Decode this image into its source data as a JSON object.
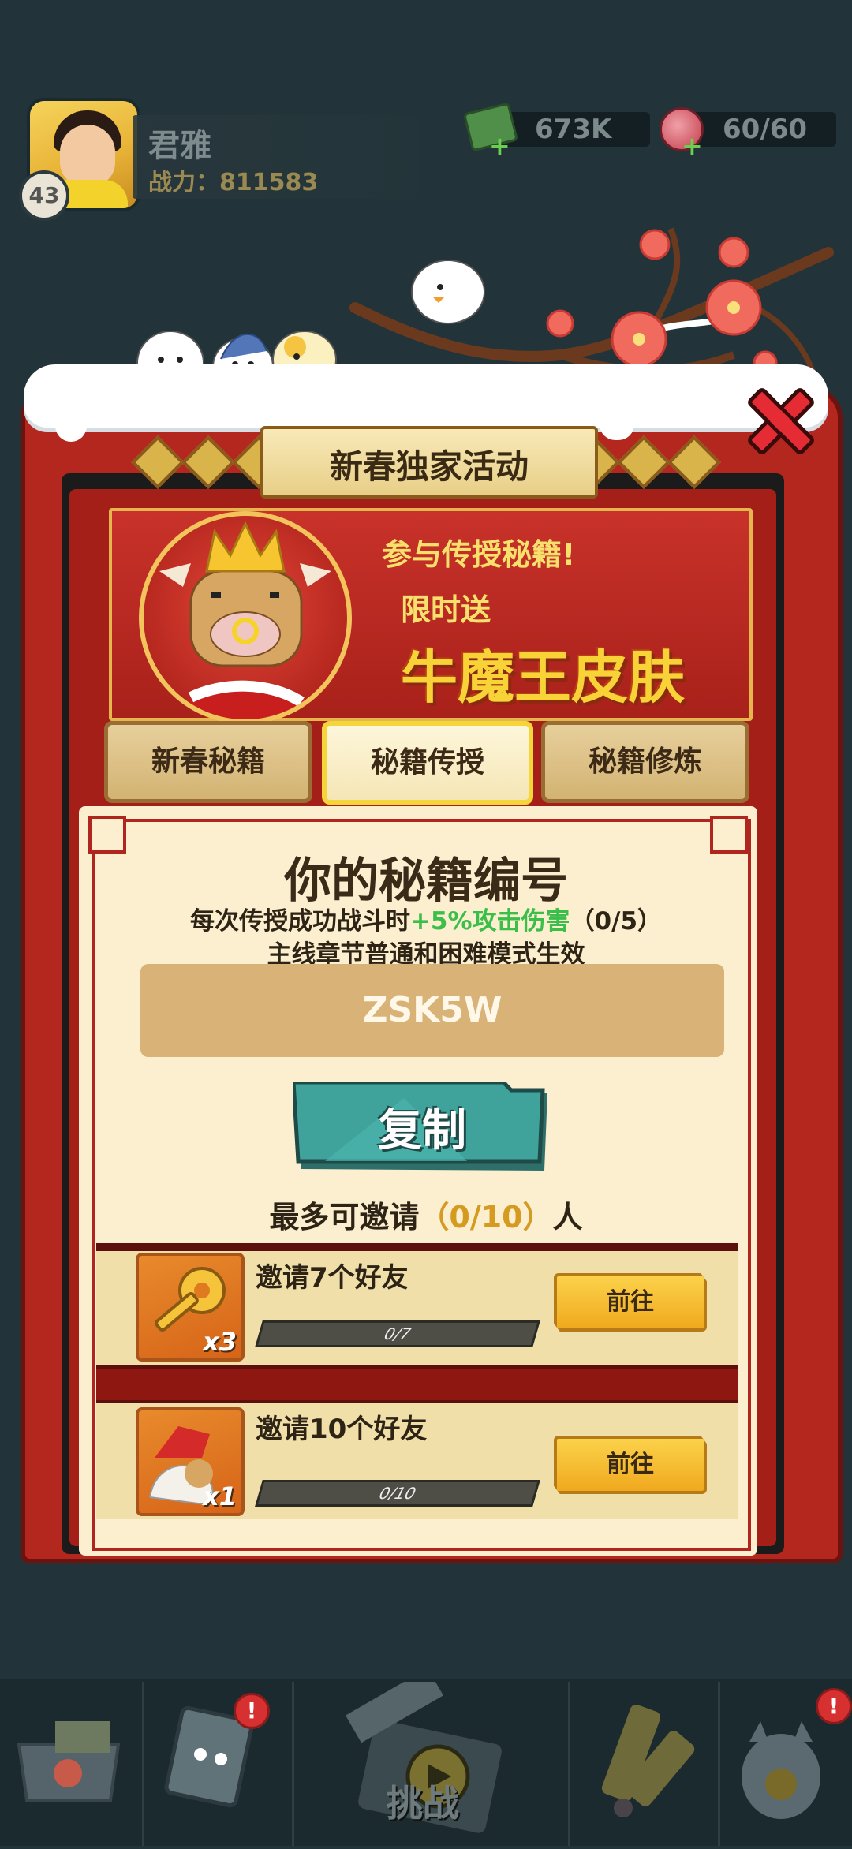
{
  "player": {
    "name": "君雅",
    "level": "43",
    "power": "战力：811583"
  },
  "resources": {
    "money": "673K",
    "stamina": "60/60"
  },
  "event": {
    "title": "新春独家活动",
    "promo_line1": "参与传授秘籍!",
    "promo_line2": "限时送",
    "promo_line3": "牛魔王皮肤"
  },
  "tabs": [
    {
      "label": "新春秘籍",
      "active": false
    },
    {
      "label": "秘籍传授",
      "active": true
    },
    {
      "label": "秘籍修炼",
      "active": false
    }
  ],
  "code_section": {
    "title": "你的秘籍编号",
    "desc_prefix": "每次传授成功战斗时",
    "desc_bonus": "+5%攻击伤害",
    "desc_suffix": "（0/5）",
    "desc_line2": "主线章节普通和困难模式生效",
    "code": "ZSK5W",
    "copy_label": "复制",
    "invite_prefix": "最多可邀请",
    "invite_count": "（0/10）",
    "invite_suffix": "人"
  },
  "rewards": [
    {
      "title": "邀请7个好友",
      "progress": "0/7",
      "progress_fraction": 0,
      "reward_count": "x3",
      "reward_icon": "key-icon",
      "button": "前往"
    },
    {
      "title": "邀请10个好友",
      "progress": "0/10",
      "progress_fraction": 0,
      "reward_count": "x1",
      "reward_icon": "bull-skin-icon",
      "button": "前往"
    }
  ],
  "nav": {
    "challenge_label": "挑战",
    "badges": [
      "!",
      "!"
    ]
  },
  "colors": {
    "panel_red": "#b3271f",
    "accent_gold": "#f8d338",
    "bonus_green": "#3cbe4a",
    "copy_teal": "#3fa39c"
  }
}
